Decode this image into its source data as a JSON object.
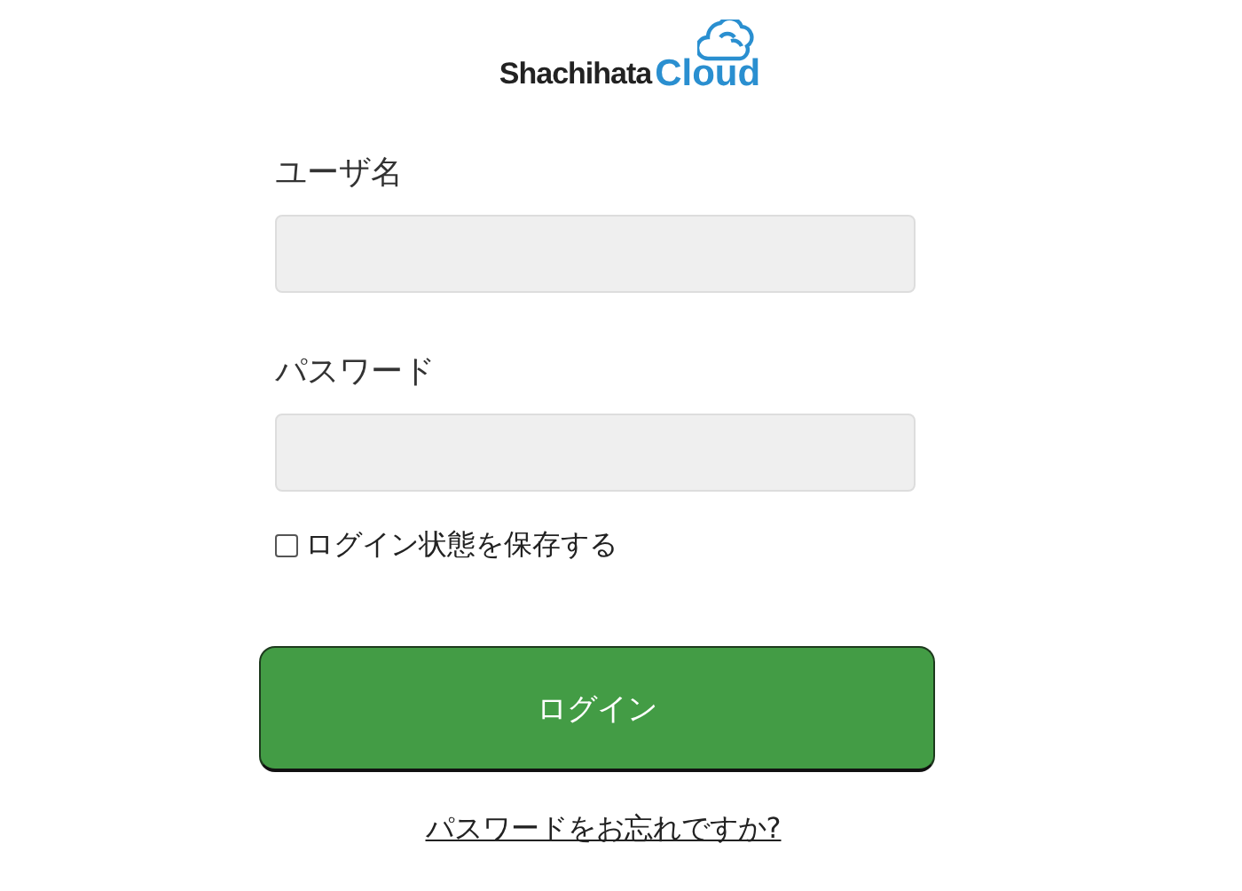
{
  "logo": {
    "brand": "Shachihata",
    "product": "Cloud"
  },
  "fields": [
    {
      "label": "ユーザ名"
    },
    {
      "label": "パスワード"
    }
  ],
  "remember": {
    "label": "ログイン状態を保存する",
    "checked": false
  },
  "login_button": {
    "label": "ログイン"
  },
  "forgot_link": {
    "label": "パスワードをお忘れですか?"
  }
}
